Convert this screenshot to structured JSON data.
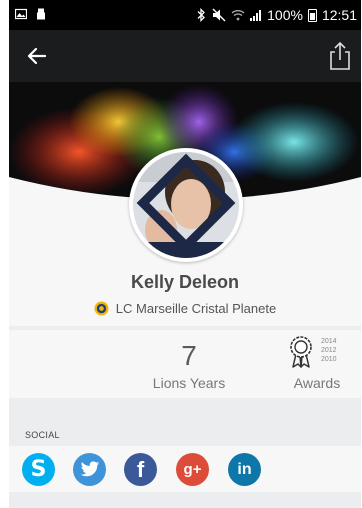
{
  "status_bar": {
    "battery_percent": "100%",
    "time": "12:51",
    "icons": [
      "gallery-icon",
      "usb-icon",
      "bluetooth-icon",
      "mute-icon",
      "wifi-icon",
      "signal-icon",
      "battery-icon"
    ]
  },
  "app_bar": {
    "back_icon": "arrow-left-icon",
    "share_icon": "share-icon"
  },
  "profile": {
    "name": "Kelly Deleon",
    "club": "LC Marseille Cristal Planete"
  },
  "stats": {
    "years_value": "7",
    "years_label": "Lions Years",
    "awards_label": "Awards",
    "award_years": [
      "2014",
      "2012",
      "2010"
    ]
  },
  "social": {
    "section_label": "SOCIAL",
    "networks": [
      {
        "name": "skype",
        "glyph": "S",
        "color": "#00aff0"
      },
      {
        "name": "twitter",
        "glyph": "",
        "color": "#3f94d9"
      },
      {
        "name": "facebook",
        "glyph": "f",
        "color": "#3b5998"
      },
      {
        "name": "google-plus",
        "glyph": "g+",
        "color": "#dd4b39"
      },
      {
        "name": "linkedin",
        "glyph": "in",
        "color": "#0e76a8"
      }
    ]
  },
  "colors": {
    "app_bar": "#1b1c1e",
    "page_bg": "#ecedef",
    "card_bg": "#f7f7f7"
  }
}
